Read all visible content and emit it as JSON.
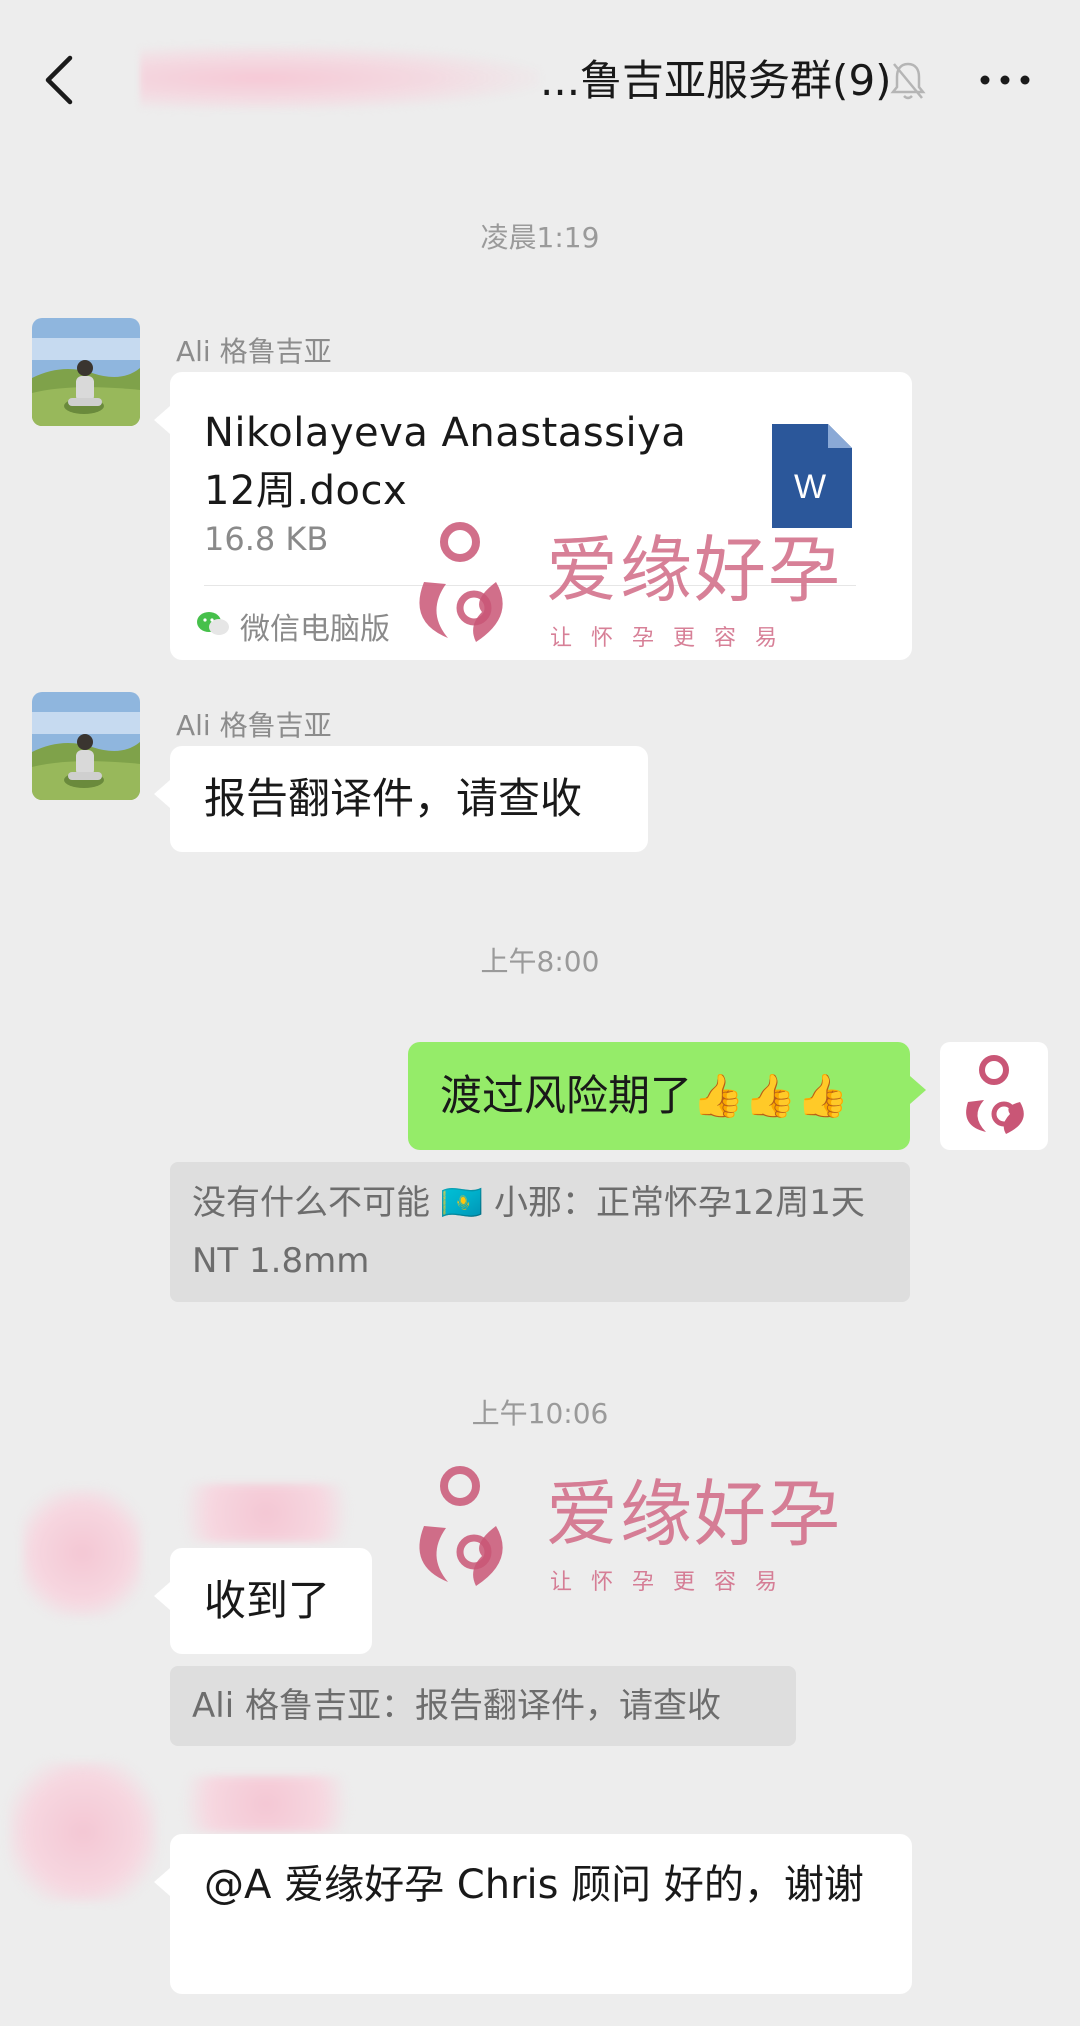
{
  "header": {
    "title": "...鲁吉亚服务群(9)"
  },
  "timestamps": {
    "t1": "凌晨1:19",
    "t2": "上午8:00",
    "t3": "上午10:06"
  },
  "messages": {
    "m1": {
      "sender": "Ali 格鲁吉亚",
      "file_name": "Nikolayeva Anastassiya 12周.docx",
      "file_size": "16.8 KB",
      "file_icon_letter": "W",
      "source": "微信电脑版"
    },
    "m2": {
      "sender": "Ali 格鲁吉亚",
      "text": "报告翻译件，请查收"
    },
    "m3": {
      "text": "渡过风险期了👍👍👍",
      "quote": "没有什么不可能 🇰🇿 小那：正常怀孕12周1天  NT 1.8mm"
    },
    "m4": {
      "text": "收到了",
      "quote": "Ali 格鲁吉亚：报告翻译件，请查收"
    },
    "m5": {
      "text": "@A 爱缘好孕 Chris 顾问  好的，谢谢"
    }
  },
  "watermark": {
    "name": "爱缘好孕",
    "slogan": "让怀孕更容易"
  },
  "colors": {
    "background": "#ededed",
    "bubble_self": "#95ec69",
    "bubble_other": "#ffffff",
    "watermark": "#d16a86",
    "word_blue": "#2b579a"
  }
}
